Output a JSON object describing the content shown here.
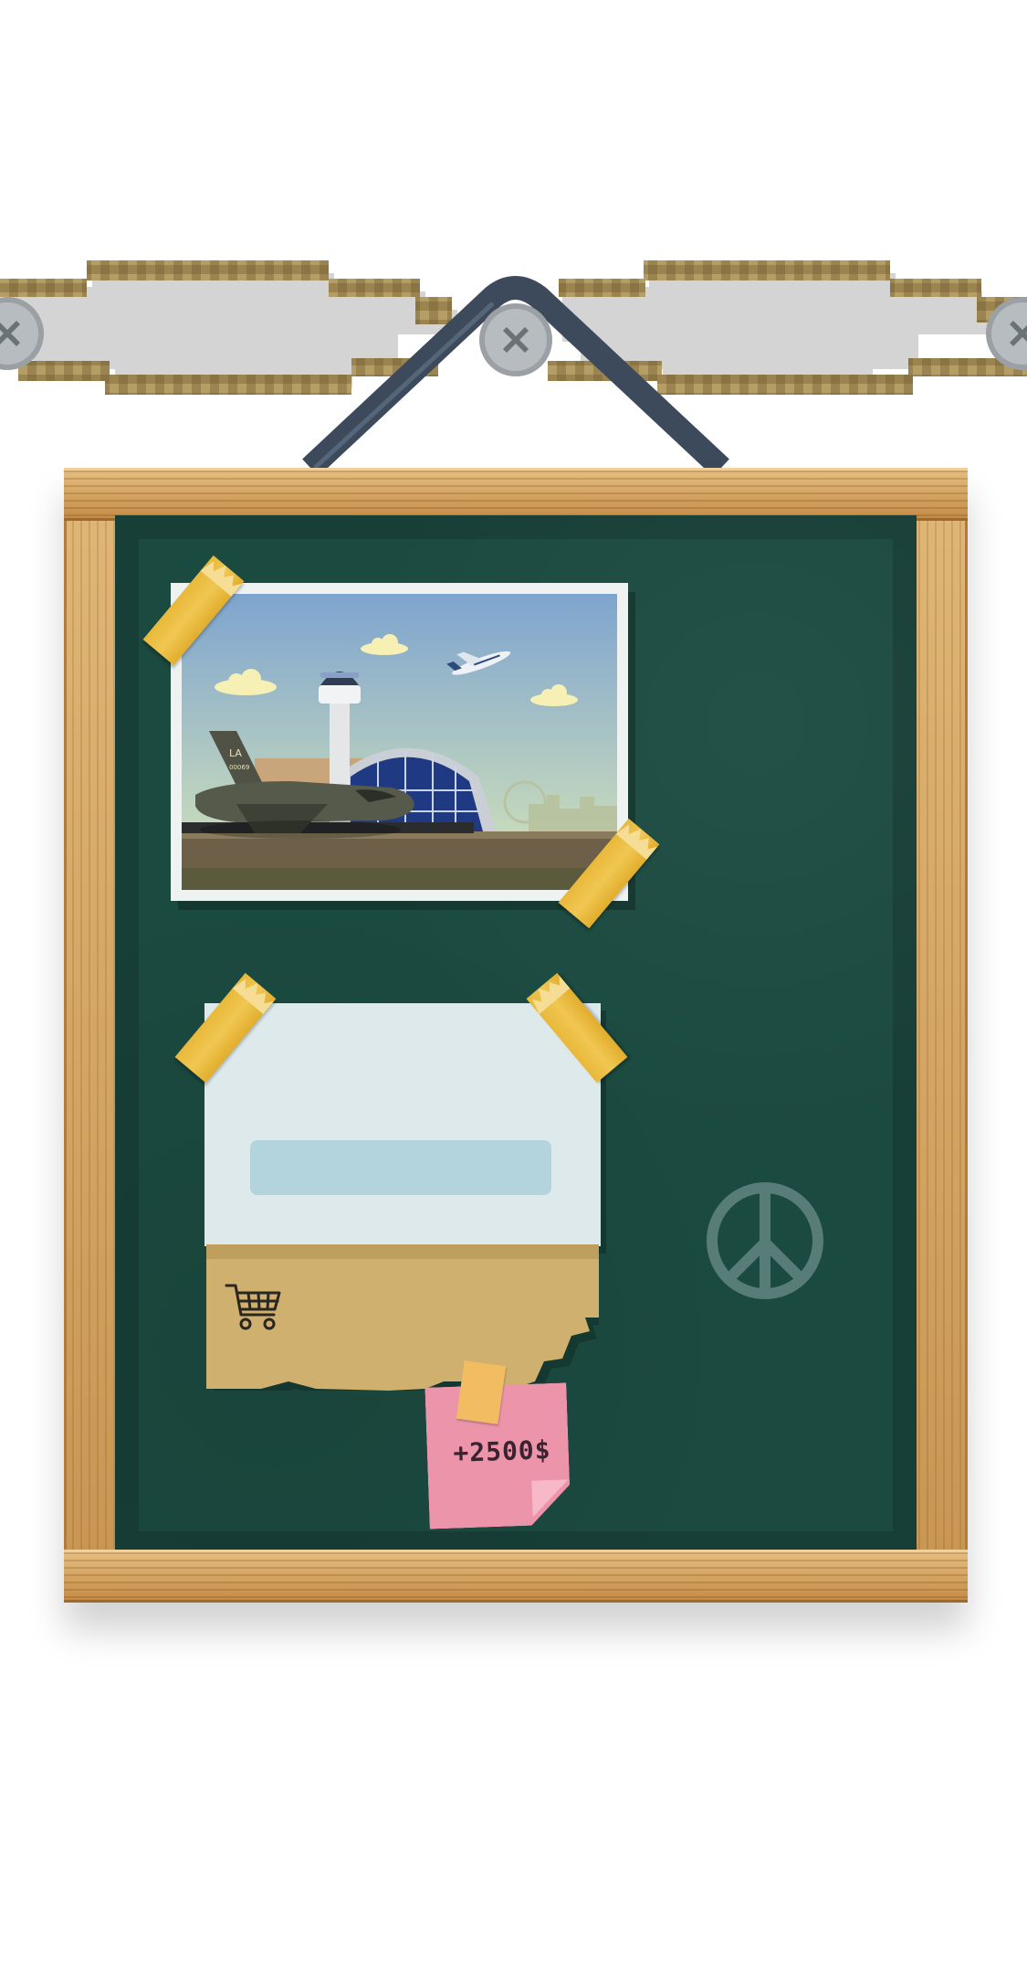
{
  "screen": {
    "name": "shop-board"
  },
  "sticky_note": {
    "text": "+2500$"
  },
  "icons": {
    "cart": "shopping-cart-icon",
    "peace": "peace-sign-icon",
    "screw": "screw-icon"
  },
  "colors": {
    "board": "#1b4a40",
    "frame": "#c89552",
    "tape": "#e8b839",
    "sticky": "#ec94aa",
    "card": "#dde9ea",
    "card_slot": "#b3d4dd",
    "card_envelope": "#cfb06f",
    "hanger_strap": "#3c4a5c"
  },
  "photo": {
    "tail_code": "LA",
    "tail_number": "00069"
  }
}
